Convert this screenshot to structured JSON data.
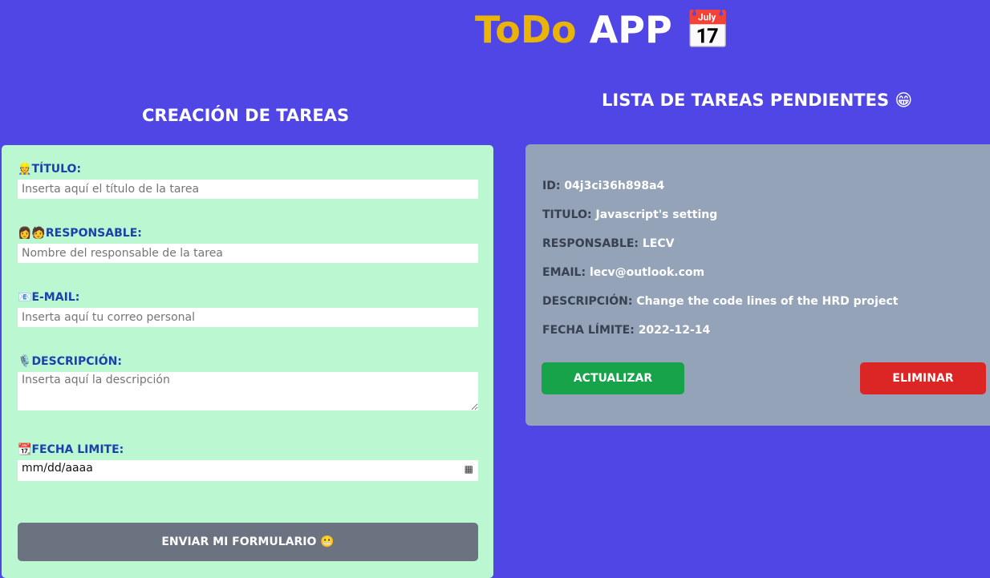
{
  "header": {
    "title_accent": "ToDo",
    "title_rest": "APP",
    "title_emoji": "📅"
  },
  "form": {
    "heading": "CREACIÓN DE TAREAS",
    "fields": [
      {
        "icon": "👷",
        "label": "TÍTULO:",
        "placeholder": "Inserta aquí el título de la tarea"
      },
      {
        "icon": "👩🧑",
        "label": "RESPONSABLE:",
        "placeholder": "Nombre del responsable de la tarea"
      },
      {
        "icon": "📧",
        "label": "E-MAIL:",
        "placeholder": "Inserta aquí tu correo personal"
      },
      {
        "icon": "🎙️",
        "label": "DESCRIPCIÓN:",
        "placeholder": "Inserta aquí la descripción"
      },
      {
        "icon": "📆",
        "label": "FECHA LIMITE:",
        "placeholder": "mm/dd/aaaa"
      }
    ],
    "submit_label": "ENVIAR MI FORMULARIO 😬"
  },
  "list": {
    "heading": "LISTA DE TAREAS PENDIENTES 😁",
    "task": {
      "rows": [
        {
          "key": "ID:",
          "value": "04j3ci36h898a4"
        },
        {
          "key": "TITULO:",
          "value": "Javascript's setting"
        },
        {
          "key": "RESPONSABLE:",
          "value": "LECV"
        },
        {
          "key": "EMAIL:",
          "value": "lecv@outlook.com"
        },
        {
          "key": "DESCRIPCIÓN:",
          "value": "Change the code lines of the HRD project"
        },
        {
          "key": "FECHA LÍMITE:",
          "value": "2022-12-14"
        }
      ],
      "update_label": "ACTUALIZAR",
      "delete_label": "ELIMINAR"
    }
  }
}
